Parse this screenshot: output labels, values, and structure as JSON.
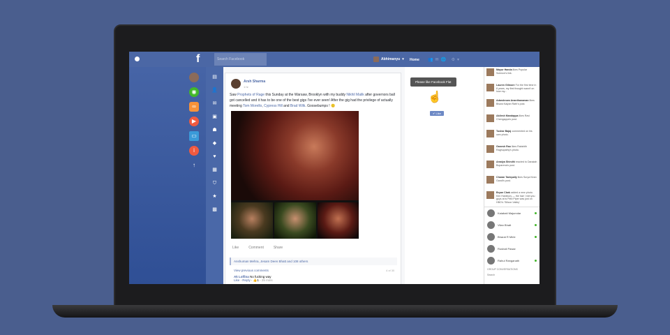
{
  "topbar": {
    "logo": "f",
    "search_placeholder": "Search Facebook",
    "user": "Abhimanyu",
    "home": "Home"
  },
  "post": {
    "author": "Arsh Sharma",
    "time": "1 hr",
    "text_parts": [
      "Saw ",
      "Prophets of Rage",
      " this Sunday at the Warsaw, Brooklyn with my buddy ",
      "Nikhil Malik",
      " after governors ball got cancelled and it has to be one of the best gigs I've ever seen! After the gig had the privilege of actually meeting ",
      "Tom Morello",
      ", ",
      "Cypress Hill",
      " and ",
      "Brad Wilk",
      ". Goosebumps ! 🙂"
    ],
    "actions": [
      "Like",
      "Comment",
      "Share"
    ],
    "reactions": "Anshuman Mehra, Jesam Deen Bhatt and 108 others",
    "view_previous": "View previous comments",
    "count": "4 of 30",
    "comment": {
      "author": "Ak Lolfina",
      "text": "No fucking way",
      "like": "Like",
      "reply": "Reply",
      "likes": "1",
      "time": "25 mins"
    }
  },
  "middle": {
    "tooltip": "Please like Facebook Flat",
    "like_button": "✔ Like"
  },
  "ticker": [
    {
      "name": "Mayur Handa",
      "text": "likes Popular Science's link."
    },
    {
      "name": "Lauren Gilmore",
      "text": "For the first time in 8 years, my first thought wasn't on how my..."
    },
    {
      "name": "Adarshnam Ananthanaman",
      "text": "likes Biswa Kalyan Rath's post."
    },
    {
      "name": "Akilesh Mandappa",
      "text": "likes Ravi Chengappa's post."
    },
    {
      "name": "Tushar Bajaj",
      "text": "commented on his own photo."
    },
    {
      "name": "Ganesh Rao",
      "text": "likes Rakshith Raghupathy's photo."
    },
    {
      "name": "Amalya Shindhi",
      "text": "reacted to Danaiah Boparena's post."
    },
    {
      "name": "Charan Tadepally",
      "text": "likes Surya Kiran Gandi's post."
    },
    {
      "name": "Bryan Clark",
      "text": "added a new photo. Ken Hardbury — the hair I met you guys at is Pied Piper was just on HBO's 'Silicon Valley'"
    }
  ],
  "chat": [
    {
      "name": "Kaiabati Majumdar",
      "online": true
    },
    {
      "name": "Vilan Bhatt",
      "online": true
    },
    {
      "name": "Bharat R Mirle",
      "online": true
    },
    {
      "name": "Rushali Pawar",
      "online": false
    },
    {
      "name": "Rahul Ranganath",
      "online": true
    }
  ],
  "group_conversations": "GROUP CONVERSATIONS",
  "chat_search": "Search",
  "colors": {
    "brand": "#4b67a5",
    "background": "#4a5e8e"
  }
}
